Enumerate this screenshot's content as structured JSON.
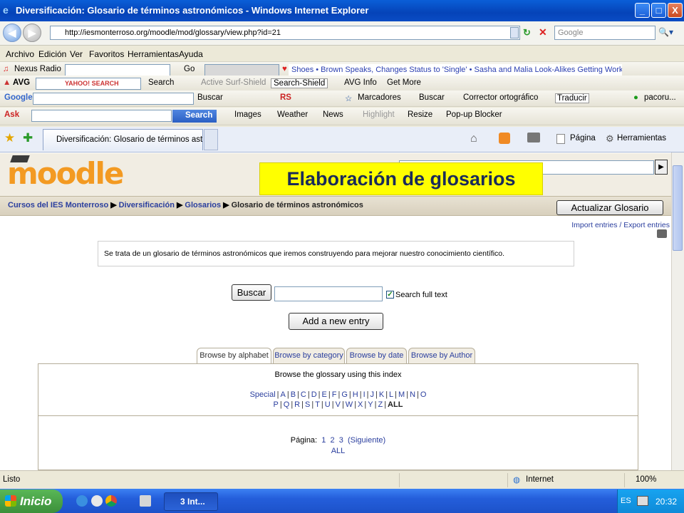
{
  "window": {
    "title": "Diversificación: Glosario de términos astronómicos - Windows Internet Explorer",
    "ie_glyph": "e",
    "min": "_",
    "max": "□",
    "close": "X"
  },
  "nav": {
    "back": "◀",
    "forward": "▶",
    "url": "http://iesmonterroso.org/moodle/mod/glossary/view.php?id=21",
    "search_placeholder": "Google",
    "search_icon": "🔍▾"
  },
  "menu": [
    "Archivo",
    "Edición",
    "Ver",
    "Favoritos",
    "Herramientas",
    "Ayuda"
  ],
  "toolbar1": {
    "nexus": "Nexus Radio",
    "go": "Go",
    "ticker": "Shoes • Brown Speaks, Changes Status to 'Single' • Sasha and Malia Look-Alikes Getting Work • Has Brown"
  },
  "toolbar2": {
    "avg": "AVG",
    "yahoo": "YAHOO! SEARCH",
    "search": "Search",
    "active": "Active Surf-Shield",
    "shield": "Search-Shield",
    "info": "AVG Info",
    "more": "Get More"
  },
  "toolbar3": {
    "google": "Google",
    "buscar": "Buscar",
    "rs": "RS",
    "marcadores": "Marcadores",
    "buscar2": "Buscar",
    "corrector": "Corrector ortográfico",
    "traducir": "Traducir",
    "pacoru": "pacoru..."
  },
  "toolbar4": {
    "ask": "Ask",
    "search_btn": "Search",
    "images": "Images",
    "weather": "Weather",
    "news": "News",
    "highlight": "Highlight",
    "resize": "Resize",
    "popup": "Pop-up Blocker"
  },
  "tabs": {
    "active": "Diversificación: Glosario de términos astro...",
    "pagina": "Página",
    "herramientas": "Herramientas"
  },
  "page": {
    "logo": "moodle",
    "banner": "Elaboración de glosarios",
    "jump_arrow": "▶",
    "crumbs": [
      {
        "label": "Cursos del IES Monterroso"
      },
      {
        "label": "Diversificación"
      },
      {
        "label": "Glosarios"
      }
    ],
    "crumb_sep": "▶",
    "crumb_current": "Glosario de términos astronómicos",
    "update_button": "Actualizar Glosario",
    "import_export": "Import entries / Export entries",
    "description": "Se trata de un glosario de términos astronómicos que iremos construyendo para mejorar nuestro conocimiento científico.",
    "search_button": "Buscar",
    "search_full_text": "Search full text",
    "add_entry": "Add a new entry",
    "browse_tabs": [
      "Browse by alphabet",
      "Browse by category",
      "Browse by date",
      "Browse by Author"
    ],
    "index_title": "Browse the glossary using this index",
    "letters_row1": [
      "Special",
      "A",
      "B",
      "C",
      "D",
      "E",
      "F",
      "G",
      "H",
      "I",
      "J",
      "K",
      "L",
      "M",
      "N",
      "O"
    ],
    "letters_row2": [
      "P",
      "Q",
      "R",
      "S",
      "T",
      "U",
      "V",
      "W",
      "X",
      "Y",
      "Z"
    ],
    "all": "ALL",
    "pagina_label": "Página:",
    "pages": [
      "1",
      "2",
      "3"
    ],
    "next": "(Siguiente)",
    "all_link": "ALL"
  },
  "status": {
    "text": "Listo",
    "zone": "Internet",
    "zoom": "100%"
  },
  "taskbar": {
    "start": "Inicio",
    "task": "3 Int...",
    "lang": "ES",
    "clock": "20:32"
  },
  "colors": {
    "link": "#2a3e9e",
    "banner_bg": "#ffff00",
    "moodle_orange": "#f39a22"
  }
}
